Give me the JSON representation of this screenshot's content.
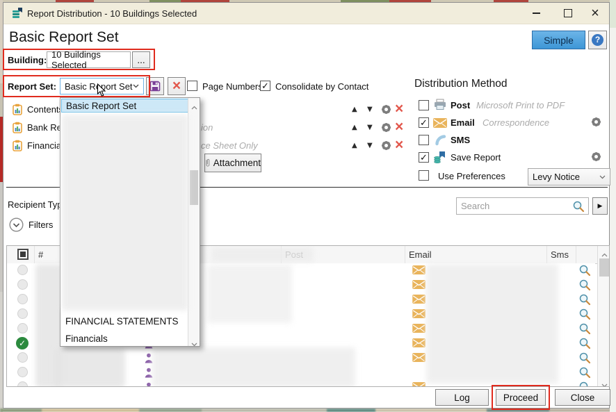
{
  "window": {
    "title": "Report Distribution - 10 Buildings Selected"
  },
  "glyphs": {
    "check": "✓",
    "up": "▲",
    "down": "▼",
    "close": "×",
    "expand": "▶",
    "help": "?",
    "hash": "#"
  },
  "header": {
    "title": "Basic Report Set",
    "simple_button": "Simple"
  },
  "building": {
    "label": "Building:",
    "value": "10 Buildings Selected",
    "browse": "..."
  },
  "report_set": {
    "label": "Report Set:",
    "value": "Basic Report Set",
    "options": [
      {
        "label": "Page Numbers",
        "check": ""
      },
      {
        "label": "Consolidate by Contact",
        "check": "✓"
      }
    ]
  },
  "report_items": [
    {
      "name": "Contents",
      "note": ""
    },
    {
      "name": "Bank Reco",
      "note": "ion"
    },
    {
      "name": "Financial S",
      "note": "ce Sheet Only"
    }
  ],
  "attachment_button": "Attachment",
  "distribution": {
    "title": "Distribution Method",
    "methods": [
      {
        "label": "Post",
        "note": "Microsoft Print to PDF",
        "check": ""
      },
      {
        "label": "Email",
        "note": "Correspondence",
        "check": "✓"
      },
      {
        "label": "SMS",
        "note": "",
        "check": ""
      },
      {
        "label": "Save Report",
        "note": "",
        "check": "✓"
      },
      {
        "label": "Use Preferences",
        "note": "",
        "check": ""
      }
    ],
    "preference_value": "Levy Notice"
  },
  "recipients": {
    "type_label": "Recipient Typ",
    "filters_label": "Filters",
    "search_placeholder": "Search"
  },
  "table": {
    "headers": {
      "number": "#",
      "post": "Post",
      "email": "Email",
      "sms": "Sms"
    },
    "rows": [
      {
        "unselected": true,
        "selected": false,
        "envelope": true
      },
      {
        "unselected": true,
        "selected": false,
        "envelope": true
      },
      {
        "unselected": true,
        "selected": false,
        "envelope": true
      },
      {
        "unselected": true,
        "selected": false,
        "envelope": true
      },
      {
        "unselected": true,
        "selected": false,
        "envelope": true
      },
      {
        "unselected": false,
        "selected": true,
        "envelope": true
      },
      {
        "unselected": true,
        "selected": false,
        "envelope": true
      },
      {
        "unselected": true,
        "selected": false,
        "envelope": false
      },
      {
        "unselected": true,
        "selected": false,
        "envelope": true
      }
    ]
  },
  "dropdown": {
    "items": [
      {
        "label": "Basic Report Set",
        "selected": true
      },
      {
        "label": "FINANCIAL STATEMENTS",
        "selected": false
      },
      {
        "label": "Financials",
        "selected": false
      }
    ]
  },
  "footer": {
    "log": "Log",
    "proceed": "Proceed",
    "close": "Close"
  },
  "colors": {
    "annotation_red": "#e02b1e",
    "accent_blue": "#3d96d6",
    "selection_blue": "#cde8f7",
    "check_green": "#2b8a3e",
    "email_orange": "#e9b45c",
    "person_purple": "#8a5fa8",
    "save_purple": "#7a3f98",
    "danger_red": "#e2574c",
    "titlebar_cream": "#f1eddc"
  }
}
